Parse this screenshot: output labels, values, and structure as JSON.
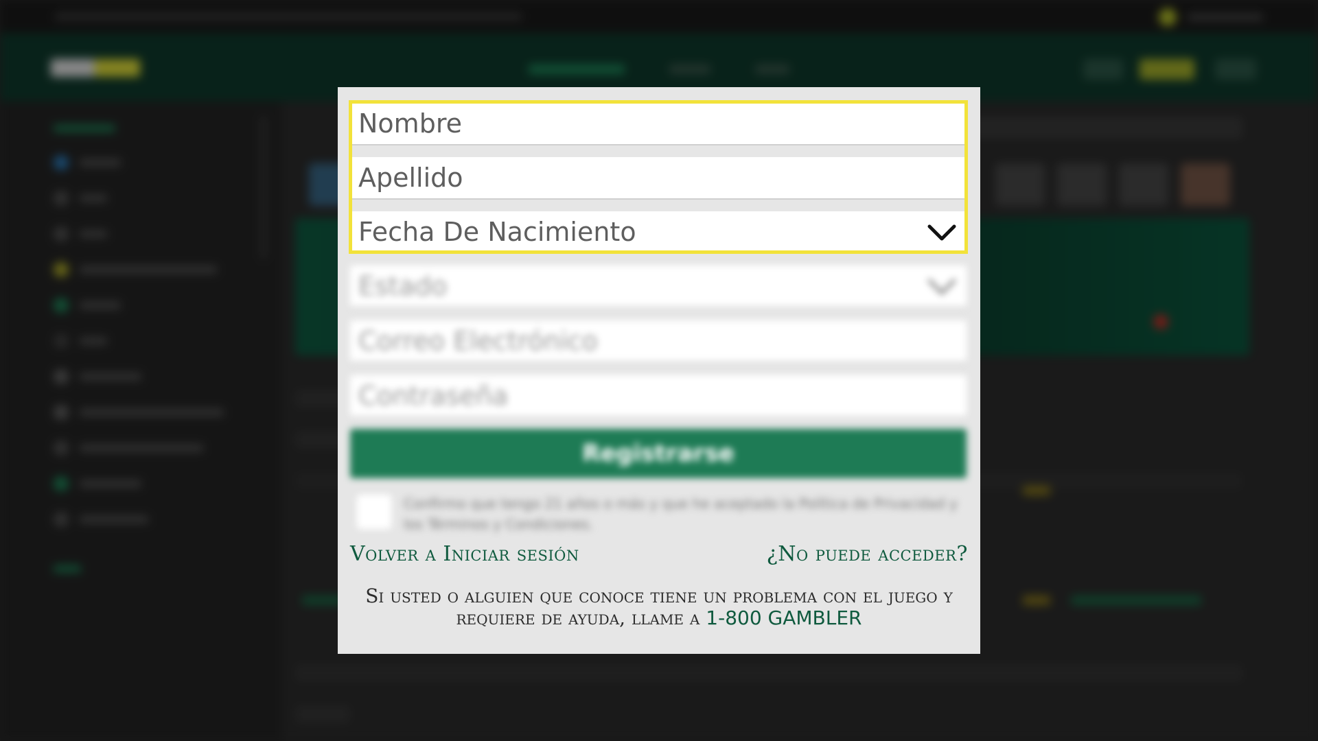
{
  "form": {
    "first_name_placeholder": "Nombre",
    "last_name_placeholder": "Apellido",
    "dob_placeholder": "Fecha De Nacimiento",
    "state_placeholder": "Estado",
    "email_placeholder": "Correo Electrónico",
    "password_placeholder": "Contraseña",
    "register_label": "Registrarse",
    "terms_text": "Confirmo que tengo 21 años o más y que he aceptado la Política de Privacidad y los Términos y Condiciones."
  },
  "links": {
    "back_to_login": "Volver a Iniciar sesión",
    "cant_access": "¿No puede acceder?"
  },
  "help": {
    "text": "Si usted o alguien que conoce tiene un problema con el juego y requiere de ayuda, llame a",
    "phone": "1-800 GAMBLER"
  },
  "colors": {
    "highlight": "#f2e23a",
    "brand_green": "#1e7b55",
    "link_green": "#0f5a3e"
  },
  "icons": {
    "dob_dropdown": "chevron-down-icon",
    "state_dropdown": "chevron-down-icon"
  }
}
